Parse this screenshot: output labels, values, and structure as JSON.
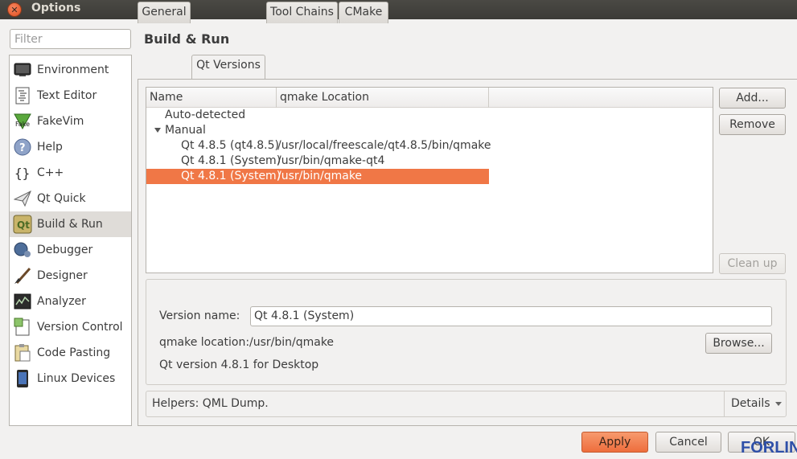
{
  "window": {
    "title": "Options"
  },
  "filter": {
    "placeholder": "Filter"
  },
  "sidebar": {
    "items": [
      {
        "label": "Environment",
        "icon": "monitor-icon"
      },
      {
        "label": "Text Editor",
        "icon": "text-editor-icon"
      },
      {
        "label": "FakeVim",
        "icon": "fakevim-icon"
      },
      {
        "label": "Help",
        "icon": "help-icon"
      },
      {
        "label": "C++",
        "icon": "cpp-braces-icon"
      },
      {
        "label": "Qt Quick",
        "icon": "paper-plane-icon"
      },
      {
        "label": "Build & Run",
        "icon": "qt-build-icon",
        "selected": true
      },
      {
        "label": "Debugger",
        "icon": "debugger-icon"
      },
      {
        "label": "Designer",
        "icon": "designer-brush-icon"
      },
      {
        "label": "Analyzer",
        "icon": "analyzer-icon"
      },
      {
        "label": "Version Control",
        "icon": "version-control-icon"
      },
      {
        "label": "Code Pasting",
        "icon": "code-pasting-icon"
      },
      {
        "label": "Linux Devices",
        "icon": "device-icon"
      }
    ]
  },
  "page": {
    "title": "Build & Run"
  },
  "tabs": [
    {
      "label": "General"
    },
    {
      "label": "Qt Versions",
      "active": true
    },
    {
      "label": "Tool Chains"
    },
    {
      "label": "CMake"
    }
  ],
  "tree": {
    "headers": [
      "Name",
      "qmake Location"
    ],
    "groups": {
      "auto": "Auto-detected",
      "manual": "Manual"
    },
    "rows": [
      {
        "name": "Qt 4.8.5 (qt4.8.5)",
        "location": "/usr/local/freescale/qt4.8.5/bin/qmake"
      },
      {
        "name": "Qt 4.8.1 (System)",
        "location": "/usr/bin/qmake-qt4"
      },
      {
        "name": "Qt 4.8.1 (System)",
        "location": "/usr/bin/qmake",
        "selected": true
      }
    ]
  },
  "buttons": {
    "add": "Add...",
    "remove": "Remove",
    "cleanup": "Clean up",
    "browse": "Browse...",
    "apply": "Apply",
    "cancel": "Cancel",
    "ok": "OK"
  },
  "details": {
    "version_name_label": "Version name:",
    "version_name_value": "Qt 4.8.1 (System)",
    "qmake_label": "qmake location:",
    "qmake_value": "/usr/bin/qmake",
    "version_info": "Qt version 4.8.1 for Desktop"
  },
  "helpers": {
    "text": "Helpers: QML Dump.",
    "details_label": "Details"
  },
  "watermark": "FORLINX",
  "colors": {
    "selection": "#f07746",
    "titlebar": "#3c3b37",
    "accent_button": "#ee6d3c"
  }
}
